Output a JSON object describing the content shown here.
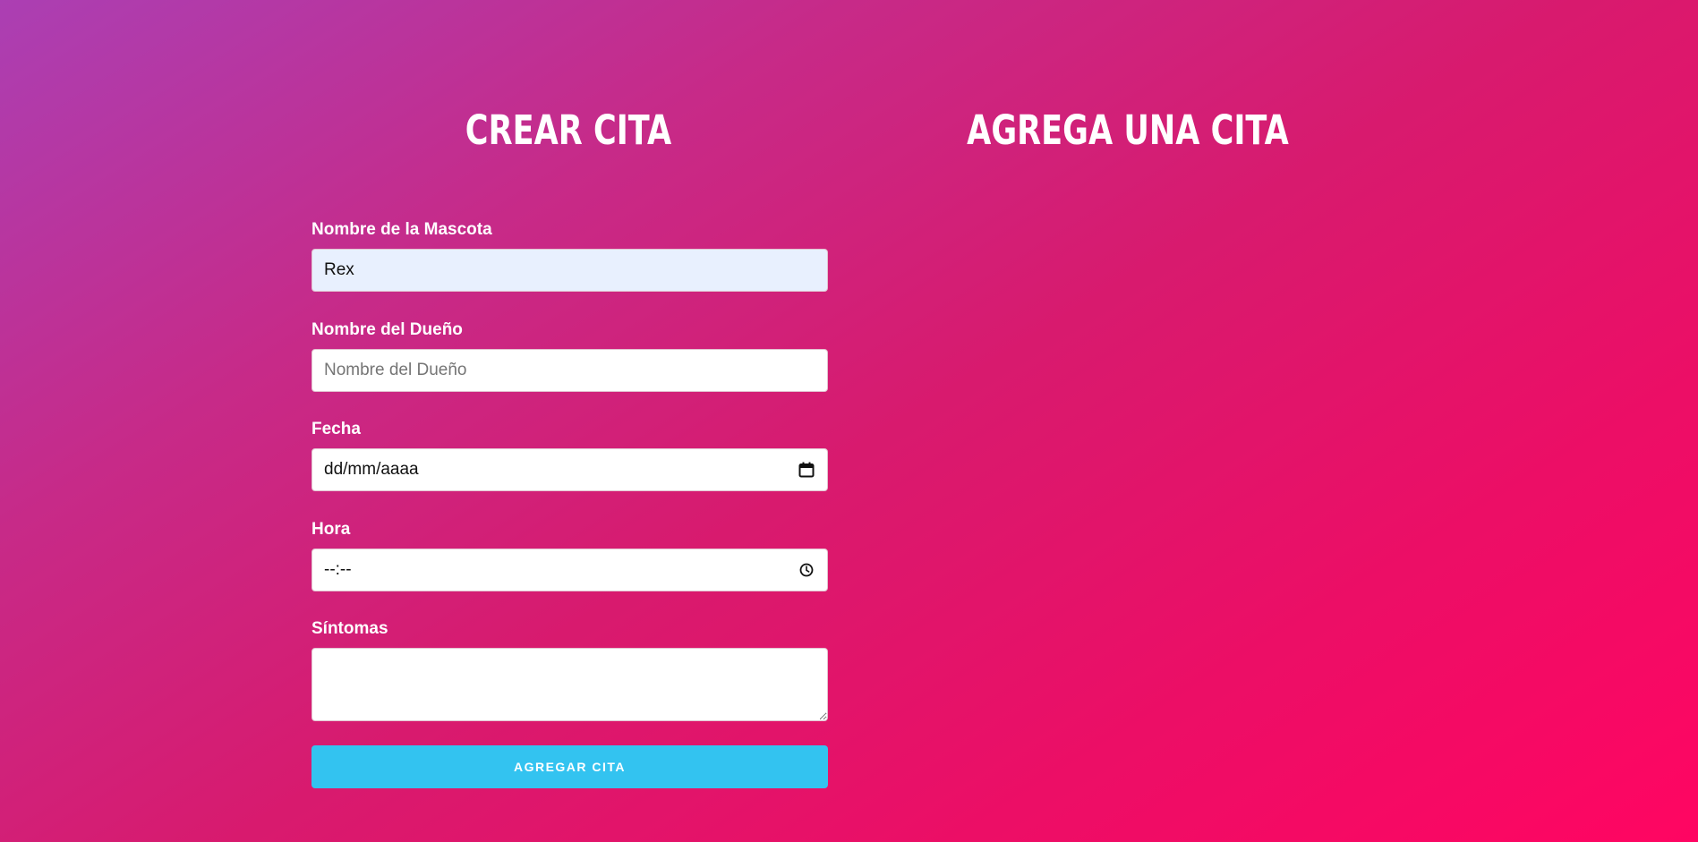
{
  "headings": {
    "create": "Crear Cita",
    "list": "Agrega una Cita"
  },
  "form": {
    "pet_name": {
      "label": "Nombre de la Mascota",
      "value": "Rex",
      "placeholder": "Nombre de la Mascota"
    },
    "owner_name": {
      "label": "Nombre del Dueño",
      "value": "",
      "placeholder": "Nombre del Dueño"
    },
    "date": {
      "label": "Fecha",
      "display": "dd/mm/aaaa",
      "icon": "calendar-icon"
    },
    "time": {
      "label": "Hora",
      "display": "--:--",
      "icon": "clock-icon"
    },
    "symptoms": {
      "label": "Síntomas",
      "value": ""
    },
    "submit_label": "Agregar Cita"
  },
  "colors": {
    "gradient_start": "#ab3fb3",
    "gradient_end": "#ff0562",
    "button": "#33c3f0",
    "autofill": "#e8f0fe"
  }
}
